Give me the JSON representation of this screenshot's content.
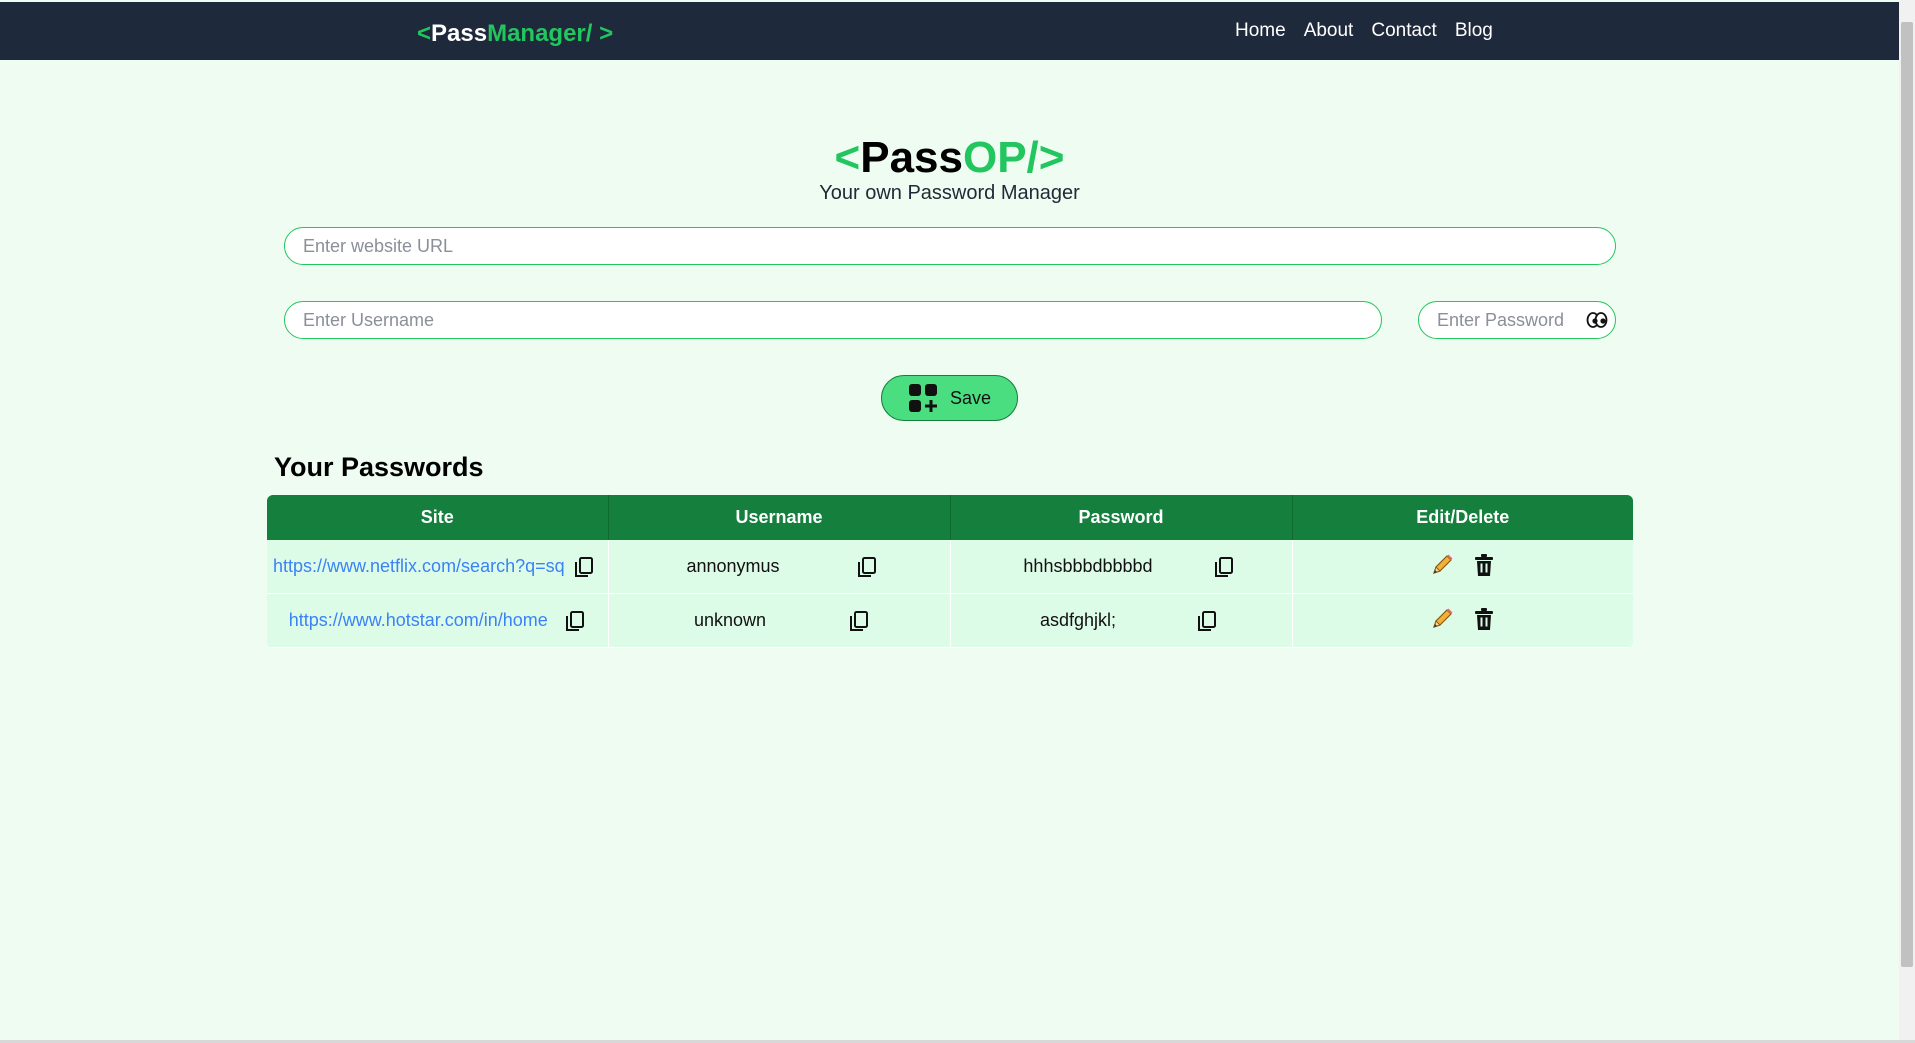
{
  "navbar": {
    "logo_open": "<",
    "logo_pass": "Pass",
    "logo_rest": "Manager/ >",
    "links": [
      "Home",
      "About",
      "Contact",
      "Blog"
    ]
  },
  "hero": {
    "brand_open": "<",
    "brand_pass": "Pass",
    "brand_rest": "OP/>",
    "tagline": "Your own Password Manager"
  },
  "form": {
    "url_placeholder": "Enter website URL",
    "username_placeholder": "Enter Username",
    "password_placeholder": "Enter Password",
    "save_label": "Save"
  },
  "passwords": {
    "title": "Your Passwords",
    "columns": [
      "Site",
      "Username",
      "Password",
      "Edit/Delete"
    ],
    "rows": [
      {
        "site": "https://www.netflix.com/search?q=sq",
        "username": "annonymus",
        "password": "hhhsbbbdbbbbd"
      },
      {
        "site": "https://www.hotstar.com/in/home",
        "username": "unknown",
        "password": "asdfghjkl;"
      }
    ]
  },
  "colors": {
    "navbar_bg": "#1e293b",
    "accent_green": "#22c55e",
    "table_header": "#15803d",
    "row_bg": "#dcfce7",
    "page_bg": "#eefcf1",
    "link": "#3b82f6"
  },
  "icons": [
    "eye-icon",
    "grid-add-icon",
    "copy-icon",
    "edit-pencil-icon",
    "trash-icon"
  ]
}
